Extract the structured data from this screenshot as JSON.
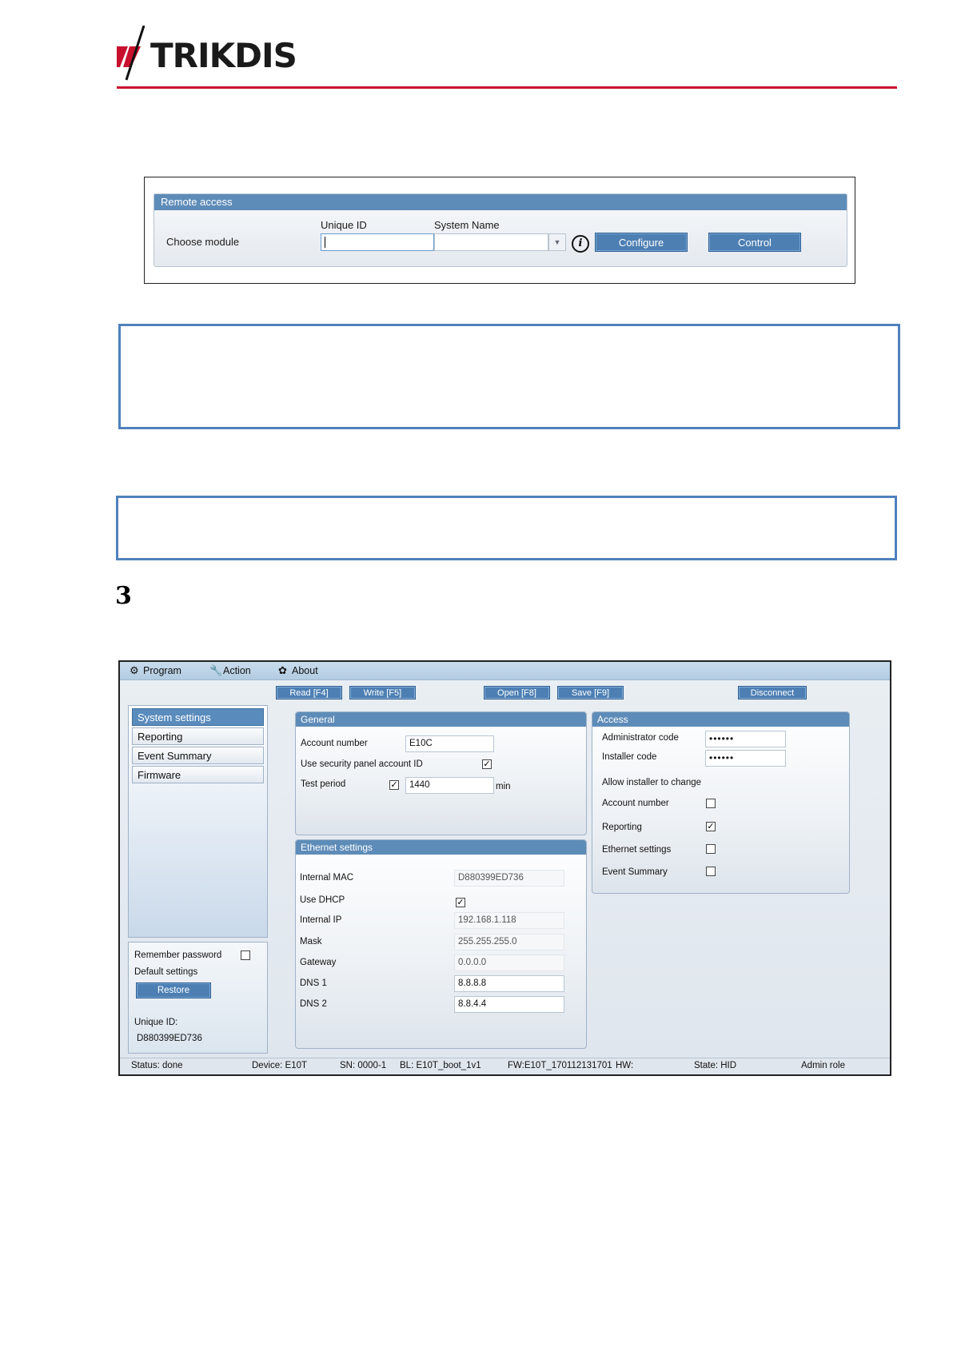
{
  "brand": {
    "logo_text": "TRIKDIS",
    "accent_color": "#c8102e"
  },
  "remote_access": {
    "title": "Remote access",
    "choose_module_label": "Choose module",
    "unique_id_label": "Unique ID",
    "system_name_label": "System Name",
    "unique_id_value": "",
    "system_name_value": "",
    "configure_label": "Configure",
    "control_label": "Control",
    "info_icon": "i"
  },
  "section_number": "3",
  "app": {
    "menu": [
      {
        "icon": "⚙",
        "label": "Program"
      },
      {
        "icon": "🔧",
        "label": "Action"
      },
      {
        "icon": "✿",
        "label": "About"
      }
    ],
    "toolbar": {
      "read": "Read [F4]",
      "write": "Write [F5]",
      "open": "Open [F8]",
      "save": "Save [F9]",
      "disconnect": "Disconnect"
    },
    "nav": [
      "System settings",
      "Reporting",
      "Event Summary",
      "Firmware"
    ],
    "side": {
      "remember_password": "Remember password",
      "default_settings": "Default settings",
      "restore": "Restore",
      "unique_id_label": "Unique ID:",
      "unique_id_value": "D880399ED736"
    },
    "general": {
      "title": "General",
      "account_number_label": "Account number",
      "account_number_value": "E10C",
      "use_panel_id_label": "Use security panel account ID",
      "test_period_label": "Test period",
      "test_period_value": "1440",
      "test_period_unit": "min"
    },
    "ethernet": {
      "title": "Ethernet settings",
      "internal_mac_label": "Internal MAC",
      "internal_mac_value": "D880399ED736",
      "use_dhcp_label": "Use DHCP",
      "internal_ip_label": "Internal IP",
      "internal_ip_value": "192.168.1.118",
      "mask_label": "Mask",
      "mask_value": "255.255.255.0",
      "gateway_label": "Gateway",
      "gateway_value": "0.0.0.0",
      "dns1_label": "DNS 1",
      "dns1_value": "8.8.8.8",
      "dns2_label": "DNS 2",
      "dns2_value": "8.8.4.4"
    },
    "access": {
      "title": "Access",
      "admin_code_label": "Administrator code",
      "admin_code_value": "••••••",
      "installer_code_label": "Installer code",
      "installer_code_value": "••••••",
      "allow_label": "Allow installer to change",
      "account_number_label": "Account number",
      "reporting_label": "Reporting",
      "ethernet_label": "Ethernet settings",
      "event_summary_label": "Event Summary"
    },
    "status": {
      "status": "Status:  done",
      "device": "Device:  E10T",
      "sn": "SN: 0000-1",
      "bl": "BL:  E10T_boot_1v1",
      "fw": "FW:E10T_170112131701",
      "hw": "HW:",
      "state": "State:  HID",
      "role": "Admin role"
    }
  }
}
